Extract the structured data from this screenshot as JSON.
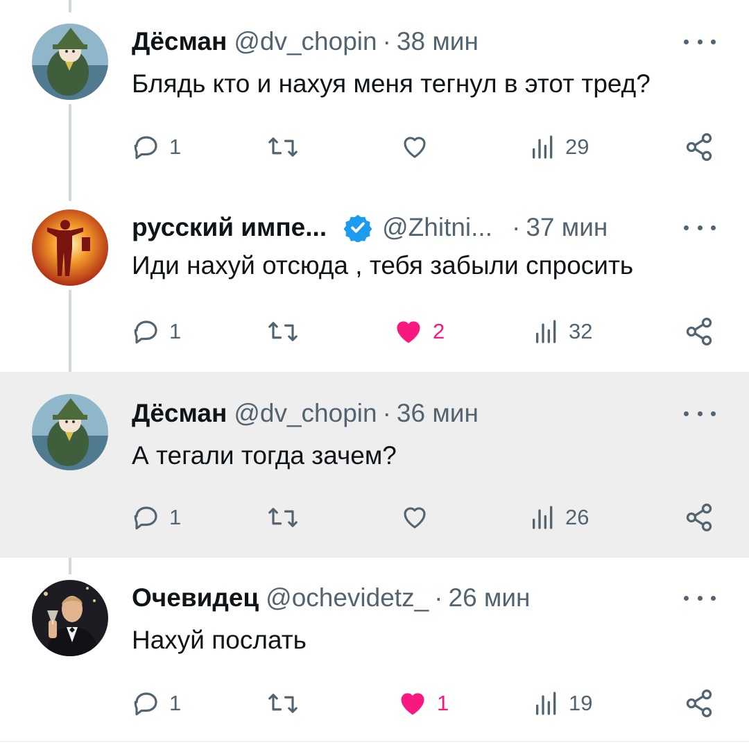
{
  "tweets": [
    {
      "name": "Дёсман",
      "handle": "@dv_chopin",
      "time": "38 мин",
      "text": "Блядь кто и нахуя меня тегнул в этот тред?",
      "replies": "1",
      "reposts": "",
      "likes": "",
      "liked": false,
      "views": "29",
      "avatar": "moomin-snufkin-avatar",
      "verified": false,
      "highlighted": false
    },
    {
      "name": "русский импе...",
      "handle": "@Zhitni...",
      "time": "37 мин",
      "text": "Иди нахуй отсюда , тебя забыли спросить",
      "replies": "1",
      "reposts": "",
      "likes": "2",
      "liked": true,
      "views": "32",
      "avatar": "red-figure-avatar",
      "verified": true,
      "highlighted": false
    },
    {
      "name": "Дёсман",
      "handle": "@dv_chopin",
      "time": "36 мин",
      "text": "А тегали тогда зачем?",
      "replies": "1",
      "reposts": "",
      "likes": "",
      "liked": false,
      "views": "26",
      "avatar": "moomin-snufkin-avatar",
      "verified": false,
      "highlighted": true
    },
    {
      "name": "Очевидец",
      "handle": "@ochevidetz_",
      "time": "26 мин",
      "text": "Нахуй послать",
      "replies": "1",
      "reposts": "",
      "likes": "1",
      "liked": true,
      "views": "19",
      "avatar": "man-toasting-avatar",
      "verified": false,
      "highlighted": false
    }
  ],
  "colors": {
    "text": "#0f1419",
    "secondary": "#536471",
    "like": "#f91880",
    "verified": "#1d9bf0",
    "highlight_bg": "#eeeeee",
    "thread_line": "#cfd9de"
  }
}
